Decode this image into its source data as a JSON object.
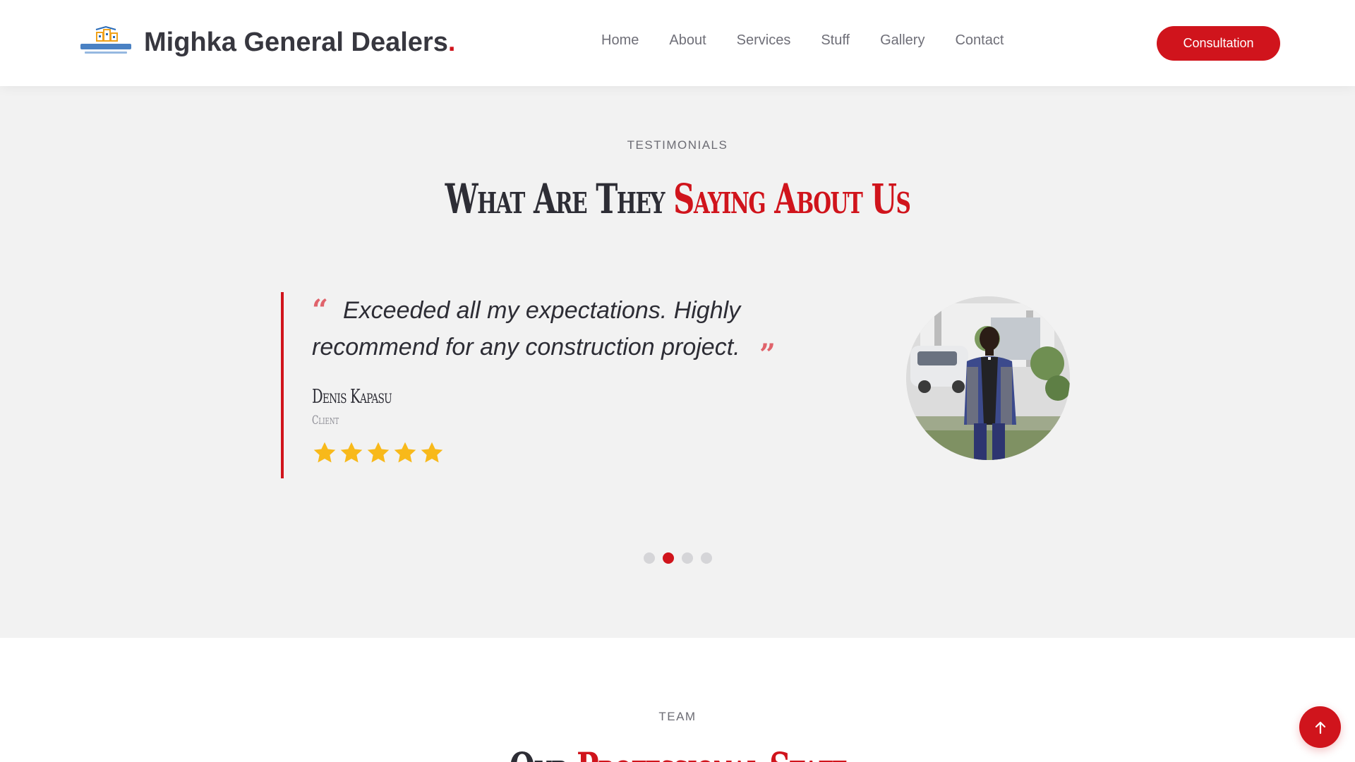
{
  "header": {
    "brand_name": "Mighka General Dealers",
    "brand_dot": ".",
    "logo_icon": "mighka-logo-icon",
    "nav": [
      {
        "label": "Home"
      },
      {
        "label": "About"
      },
      {
        "label": "Services"
      },
      {
        "label": "Stuff"
      },
      {
        "label": "Gallery"
      },
      {
        "label": "Contact"
      }
    ],
    "cta_label": "Consultation"
  },
  "testimonials": {
    "eyebrow": "TESTIMONIALS",
    "title_main": "What Are They ",
    "title_accent": "Saying About Us",
    "quote_open": "“",
    "quote_close": "”",
    "quote": "Exceeded all my expectations. Highly recommend for any construction project.",
    "client_name": "Denis Kapasu",
    "client_role": "Client",
    "rating": 5,
    "rating_max": 5,
    "photo_icon": "client-photo",
    "slider": {
      "count": 4,
      "active_index": 1
    }
  },
  "team": {
    "eyebrow": "TEAM",
    "title_main": "Our ",
    "title_accent": "Professional Staff"
  },
  "back_to_top_icon": "arrow-up-icon",
  "colors": {
    "accent": "#d0141c",
    "star": "#f8b91a",
    "section_bg": "#f2f2f2",
    "text": "#2d2d35"
  }
}
